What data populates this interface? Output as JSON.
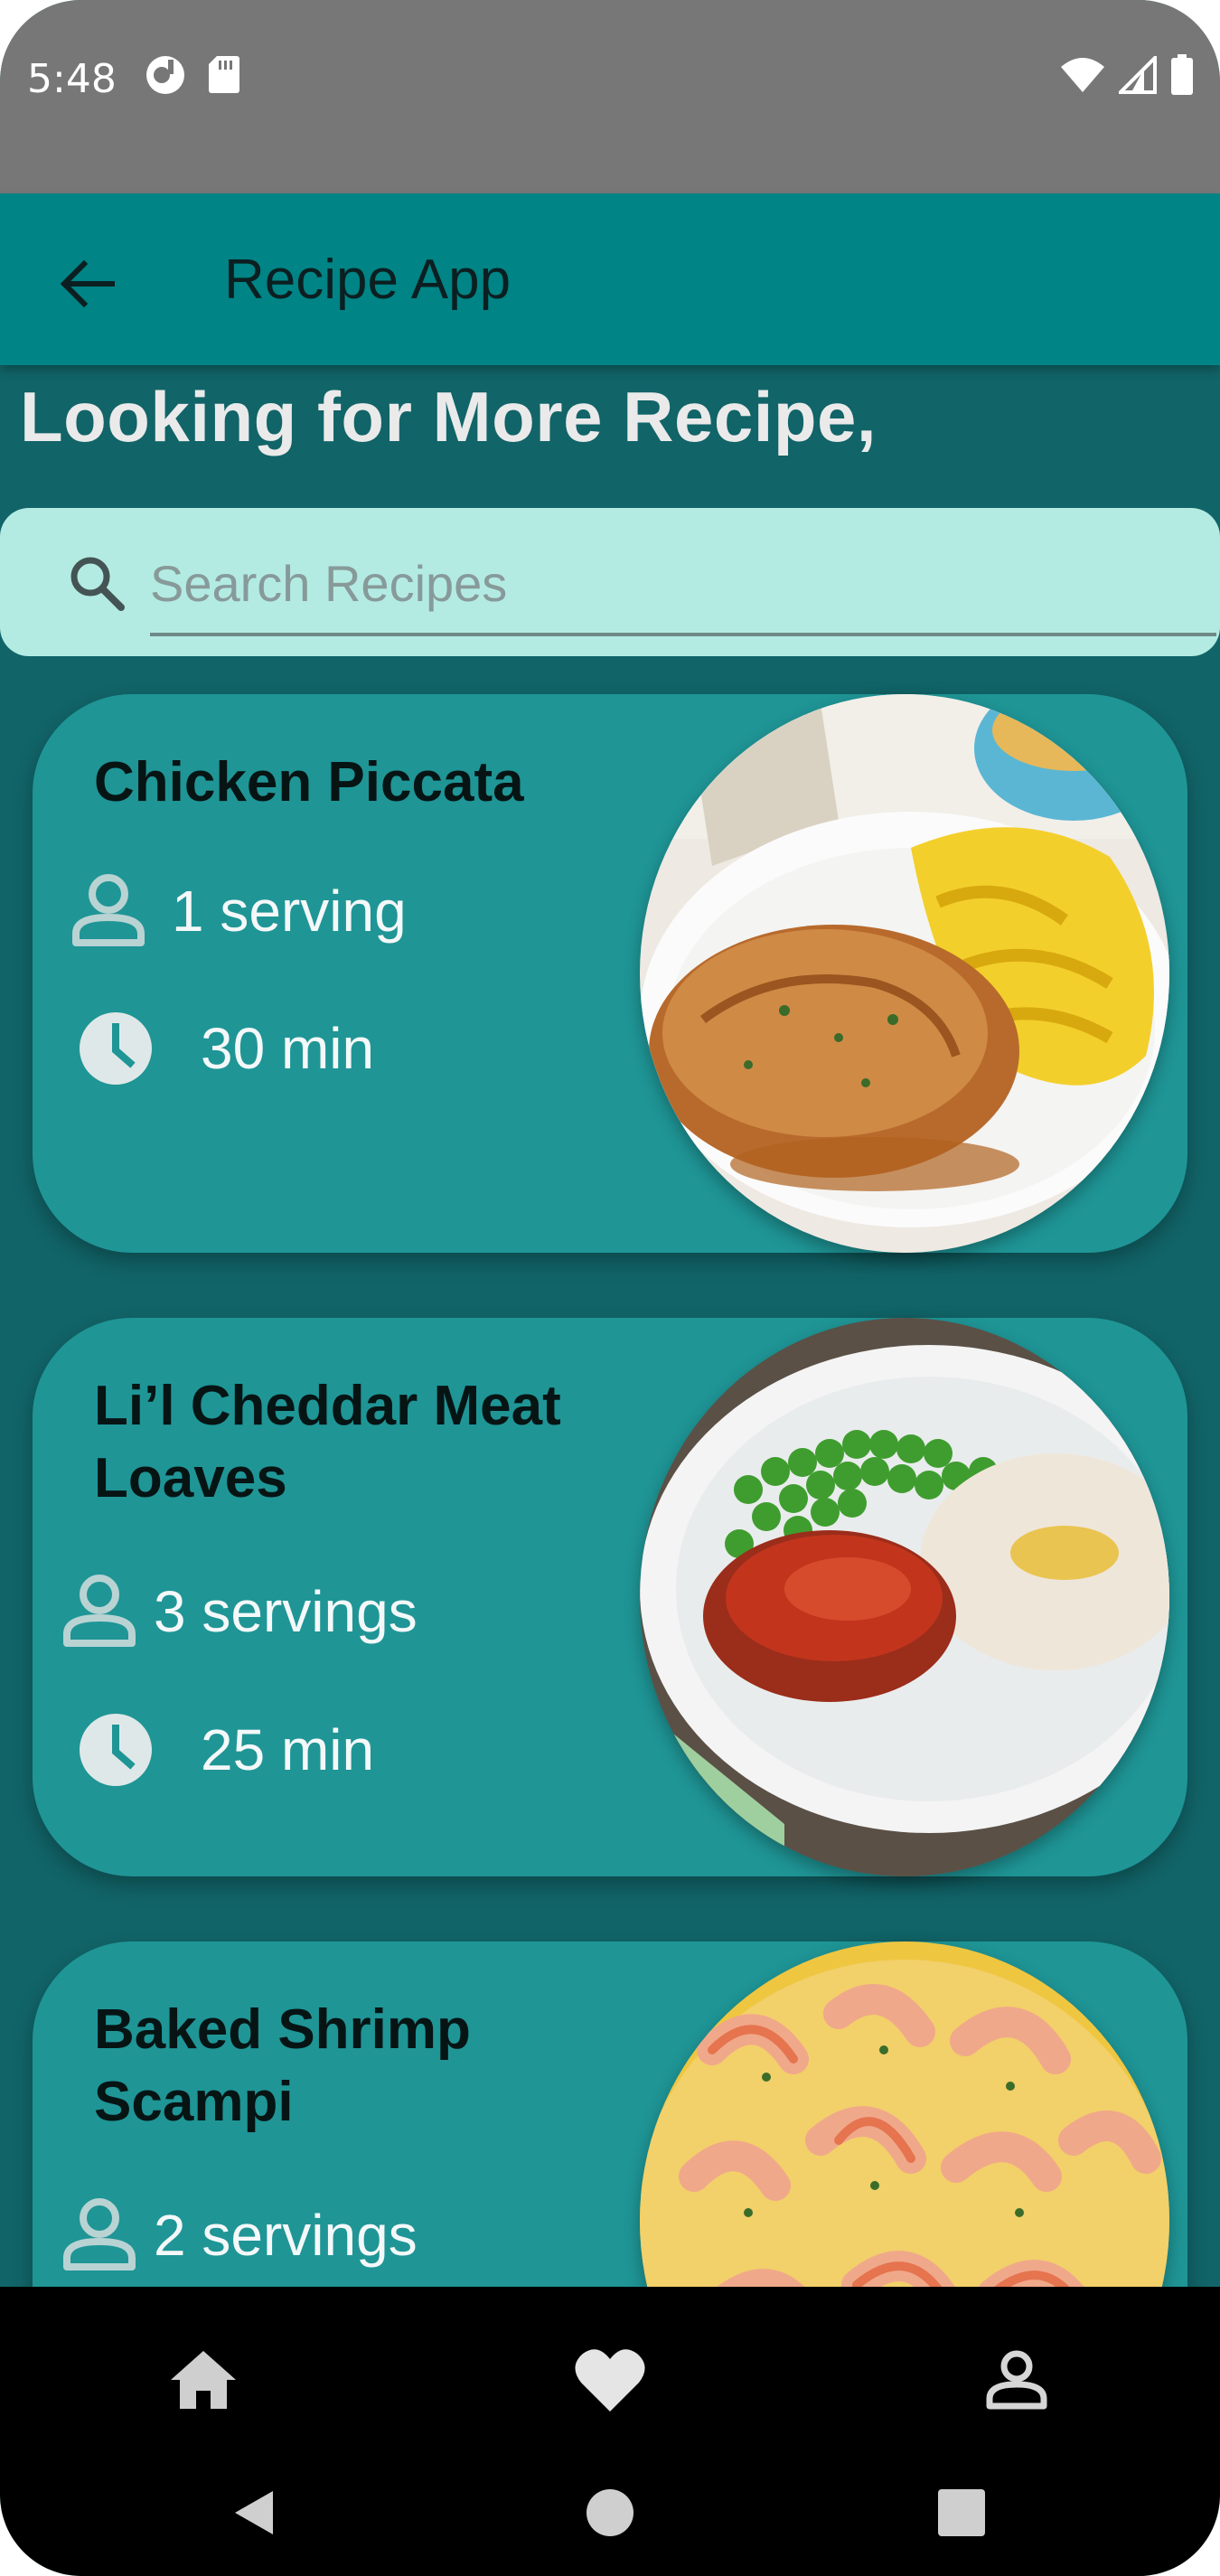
{
  "status_bar": {
    "time": "5:48"
  },
  "app_bar": {
    "title": "Recipe App"
  },
  "greeting": "Looking for More Recipe,",
  "search": {
    "placeholder": "Search Recipes",
    "value": ""
  },
  "recipes": [
    {
      "title": "Chicken Piccata",
      "servings": "1 serving",
      "time": "30 min"
    },
    {
      "title": "Li’l Cheddar Meat Loaves",
      "servings": "3 servings",
      "time": "25 min"
    },
    {
      "title": "Baked Shrimp Scampi",
      "servings": "2 servings",
      "time": ""
    }
  ],
  "bottom_nav": {
    "items": [
      "home-icon",
      "heart-icon",
      "person-icon"
    ]
  },
  "system_nav": {
    "items": [
      "back-icon",
      "home-circle-icon",
      "recents-icon"
    ]
  },
  "colors": {
    "status_bar": "#777777",
    "app_bar": "#008486",
    "background": "#116468",
    "search_bg": "#b3ebe3",
    "card_bg": "#1f9596"
  }
}
